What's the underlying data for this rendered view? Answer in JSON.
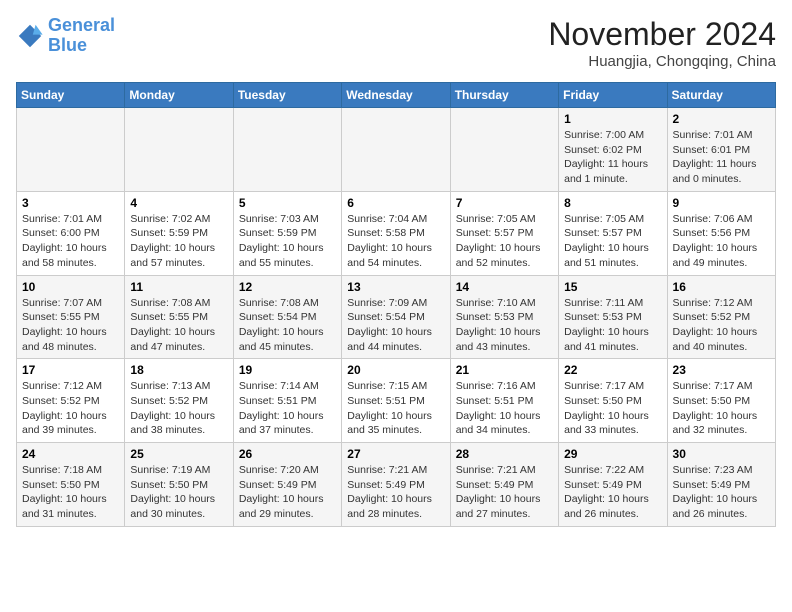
{
  "logo": {
    "line1": "General",
    "line2": "Blue"
  },
  "title": "November 2024",
  "location": "Huangjia, Chongqing, China",
  "days_of_week": [
    "Sunday",
    "Monday",
    "Tuesday",
    "Wednesday",
    "Thursday",
    "Friday",
    "Saturday"
  ],
  "weeks": [
    [
      {
        "num": "",
        "info": ""
      },
      {
        "num": "",
        "info": ""
      },
      {
        "num": "",
        "info": ""
      },
      {
        "num": "",
        "info": ""
      },
      {
        "num": "",
        "info": ""
      },
      {
        "num": "1",
        "info": "Sunrise: 7:00 AM\nSunset: 6:02 PM\nDaylight: 11 hours\nand 1 minute."
      },
      {
        "num": "2",
        "info": "Sunrise: 7:01 AM\nSunset: 6:01 PM\nDaylight: 11 hours\nand 0 minutes."
      }
    ],
    [
      {
        "num": "3",
        "info": "Sunrise: 7:01 AM\nSunset: 6:00 PM\nDaylight: 10 hours\nand 58 minutes."
      },
      {
        "num": "4",
        "info": "Sunrise: 7:02 AM\nSunset: 5:59 PM\nDaylight: 10 hours\nand 57 minutes."
      },
      {
        "num": "5",
        "info": "Sunrise: 7:03 AM\nSunset: 5:59 PM\nDaylight: 10 hours\nand 55 minutes."
      },
      {
        "num": "6",
        "info": "Sunrise: 7:04 AM\nSunset: 5:58 PM\nDaylight: 10 hours\nand 54 minutes."
      },
      {
        "num": "7",
        "info": "Sunrise: 7:05 AM\nSunset: 5:57 PM\nDaylight: 10 hours\nand 52 minutes."
      },
      {
        "num": "8",
        "info": "Sunrise: 7:05 AM\nSunset: 5:57 PM\nDaylight: 10 hours\nand 51 minutes."
      },
      {
        "num": "9",
        "info": "Sunrise: 7:06 AM\nSunset: 5:56 PM\nDaylight: 10 hours\nand 49 minutes."
      }
    ],
    [
      {
        "num": "10",
        "info": "Sunrise: 7:07 AM\nSunset: 5:55 PM\nDaylight: 10 hours\nand 48 minutes."
      },
      {
        "num": "11",
        "info": "Sunrise: 7:08 AM\nSunset: 5:55 PM\nDaylight: 10 hours\nand 47 minutes."
      },
      {
        "num": "12",
        "info": "Sunrise: 7:08 AM\nSunset: 5:54 PM\nDaylight: 10 hours\nand 45 minutes."
      },
      {
        "num": "13",
        "info": "Sunrise: 7:09 AM\nSunset: 5:54 PM\nDaylight: 10 hours\nand 44 minutes."
      },
      {
        "num": "14",
        "info": "Sunrise: 7:10 AM\nSunset: 5:53 PM\nDaylight: 10 hours\nand 43 minutes."
      },
      {
        "num": "15",
        "info": "Sunrise: 7:11 AM\nSunset: 5:53 PM\nDaylight: 10 hours\nand 41 minutes."
      },
      {
        "num": "16",
        "info": "Sunrise: 7:12 AM\nSunset: 5:52 PM\nDaylight: 10 hours\nand 40 minutes."
      }
    ],
    [
      {
        "num": "17",
        "info": "Sunrise: 7:12 AM\nSunset: 5:52 PM\nDaylight: 10 hours\nand 39 minutes."
      },
      {
        "num": "18",
        "info": "Sunrise: 7:13 AM\nSunset: 5:52 PM\nDaylight: 10 hours\nand 38 minutes."
      },
      {
        "num": "19",
        "info": "Sunrise: 7:14 AM\nSunset: 5:51 PM\nDaylight: 10 hours\nand 37 minutes."
      },
      {
        "num": "20",
        "info": "Sunrise: 7:15 AM\nSunset: 5:51 PM\nDaylight: 10 hours\nand 35 minutes."
      },
      {
        "num": "21",
        "info": "Sunrise: 7:16 AM\nSunset: 5:51 PM\nDaylight: 10 hours\nand 34 minutes."
      },
      {
        "num": "22",
        "info": "Sunrise: 7:17 AM\nSunset: 5:50 PM\nDaylight: 10 hours\nand 33 minutes."
      },
      {
        "num": "23",
        "info": "Sunrise: 7:17 AM\nSunset: 5:50 PM\nDaylight: 10 hours\nand 32 minutes."
      }
    ],
    [
      {
        "num": "24",
        "info": "Sunrise: 7:18 AM\nSunset: 5:50 PM\nDaylight: 10 hours\nand 31 minutes."
      },
      {
        "num": "25",
        "info": "Sunrise: 7:19 AM\nSunset: 5:50 PM\nDaylight: 10 hours\nand 30 minutes."
      },
      {
        "num": "26",
        "info": "Sunrise: 7:20 AM\nSunset: 5:49 PM\nDaylight: 10 hours\nand 29 minutes."
      },
      {
        "num": "27",
        "info": "Sunrise: 7:21 AM\nSunset: 5:49 PM\nDaylight: 10 hours\nand 28 minutes."
      },
      {
        "num": "28",
        "info": "Sunrise: 7:21 AM\nSunset: 5:49 PM\nDaylight: 10 hours\nand 27 minutes."
      },
      {
        "num": "29",
        "info": "Sunrise: 7:22 AM\nSunset: 5:49 PM\nDaylight: 10 hours\nand 26 minutes."
      },
      {
        "num": "30",
        "info": "Sunrise: 7:23 AM\nSunset: 5:49 PM\nDaylight: 10 hours\nand 26 minutes."
      }
    ]
  ]
}
